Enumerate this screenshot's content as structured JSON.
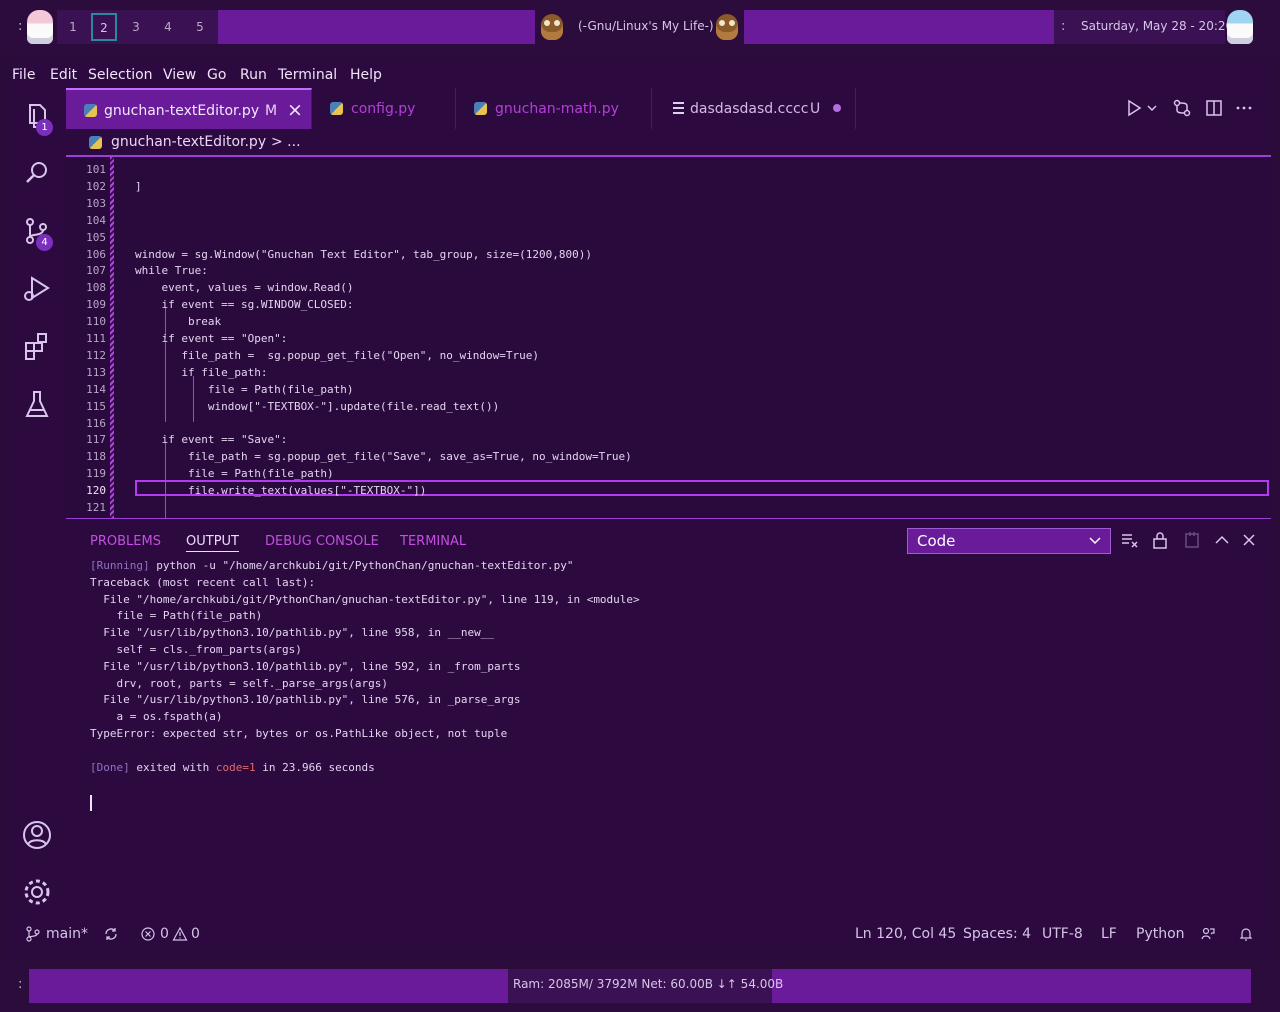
{
  "top_panel": {
    "left_colon": ":",
    "workspaces": [
      "1",
      "2",
      "3",
      "4",
      "5"
    ],
    "active_workspace": "2",
    "title": "(-Gnu/Linux's My Life-)",
    "right_colon": ":",
    "clock": "Saturday, May 28 - 20:20"
  },
  "menu": [
    "File",
    "Edit",
    "Selection",
    "View",
    "Go",
    "Run",
    "Terminal",
    "Help"
  ],
  "activity": {
    "explorer_badge": "1",
    "scm_badge": "4"
  },
  "tabs": [
    {
      "label": "gnuchan-textEditor.py",
      "status": "M",
      "close": "×"
    },
    {
      "label": "config.py"
    },
    {
      "label": "gnuchan-math.py"
    },
    {
      "label": "dasdasdasd.cccc",
      "status": "U"
    }
  ],
  "breadcrumb": {
    "file": "gnuchan-textEditor.py",
    "rest": "> ..."
  },
  "editor": {
    "line_numbers": [
      "101",
      "102",
      "103",
      "104",
      "105",
      "106",
      "107",
      "108",
      "109",
      "110",
      "111",
      "112",
      "113",
      "114",
      "115",
      "116",
      "117",
      "118",
      "119",
      "120",
      "121"
    ],
    "current_line": "120",
    "lines": [
      "",
      "]",
      "",
      "",
      "",
      "window = sg.Window(\"Gnuchan Text Editor\", tab_group, size=(1200,800))",
      "while True:",
      "    event, values = window.Read()",
      "    if event == sg.WINDOW_CLOSED:",
      "        break",
      "    if event == \"Open\":",
      "       file_path =  sg.popup_get_file(\"Open\", no_window=True)",
      "       if file_path:",
      "           file = Path(file_path)",
      "           window[\"-TEXTBOX-\"].update(file.read_text())",
      "",
      "    if event == \"Save\":",
      "        file_path = sg.popup_get_file(\"Save\", save_as=True, no_window=True)",
      "        file = Path(file_path)",
      "        file.write_text(values[\"-TEXTBOX-\"])",
      ""
    ]
  },
  "panel": {
    "tabs": [
      "PROBLEMS",
      "OUTPUT",
      "DEBUG CONSOLE",
      "TERMINAL"
    ],
    "active_tab": "OUTPUT",
    "output_select": "Code",
    "output_lines": [
      {
        "prefix": "[Running]",
        "text": " python -u \"/home/archkubi/git/PythonChan/gnuchan-textEditor.py\""
      },
      {
        "text": "Traceback (most recent call last):"
      },
      {
        "text": "  File \"/home/archkubi/git/PythonChan/gnuchan-textEditor.py\", line 119, in <module>"
      },
      {
        "text": "    file = Path(file_path)"
      },
      {
        "text": "  File \"/usr/lib/python3.10/pathlib.py\", line 958, in __new__"
      },
      {
        "text": "    self = cls._from_parts(args)"
      },
      {
        "text": "  File \"/usr/lib/python3.10/pathlib.py\", line 592, in _from_parts"
      },
      {
        "text": "    drv, root, parts = self._parse_args(args)"
      },
      {
        "text": "  File \"/usr/lib/python3.10/pathlib.py\", line 576, in _parse_args"
      },
      {
        "text": "    a = os.fspath(a)"
      },
      {
        "text": "TypeError: expected str, bytes or os.PathLike object, not tuple"
      },
      {
        "text": ""
      },
      {
        "prefix": "[Done]",
        "text": " exited with ",
        "code": "code=1",
        "tail": " in 23.966 seconds"
      }
    ]
  },
  "status": {
    "branch": "main*",
    "errors": "0",
    "warnings": "0",
    "position": "Ln 120, Col 45",
    "spaces": "Spaces: 4",
    "encoding": "UTF-8",
    "eol": "LF",
    "language": "Python"
  },
  "bottom_panel": {
    "colon": ":",
    "sys_info": "Ram:  2085M/ 3792M    Net:  60.00B ↓↑  54.00B"
  },
  "colors": {
    "accent": "#6a1b9a",
    "background": "#2c0a40",
    "tab_label": "#c44fe0"
  }
}
